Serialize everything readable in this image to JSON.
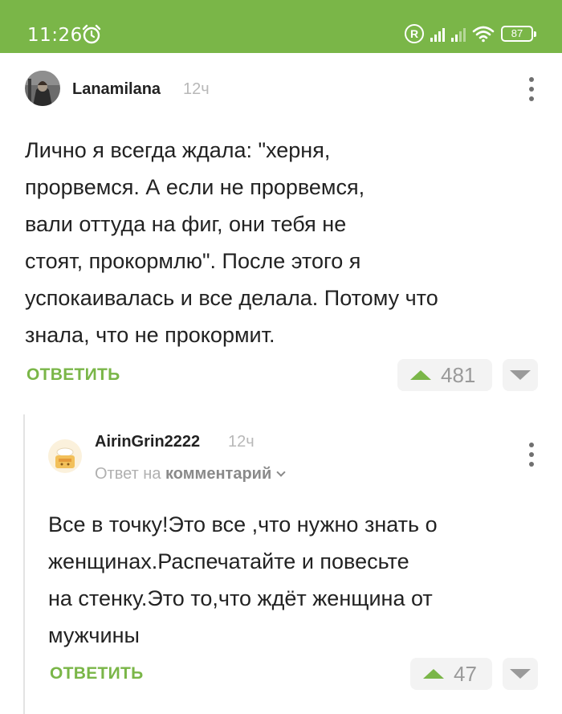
{
  "status_bar": {
    "time": "11:26",
    "battery": "87",
    "accent": "#7ab648",
    "icons": [
      "alarm-icon",
      "registered-icon",
      "signal-icon",
      "signal-icon",
      "wifi-icon",
      "battery-icon"
    ]
  },
  "comments": [
    {
      "author": "Lanamilana",
      "ago": "12ч",
      "text_lines": [
        "Лично я всегда ждала: \"херня,",
        "прорвемся. А если не прорвемся,",
        "вали оттуда на фиг, они тебя не",
        "стоят, прокормлю\". После этого я",
        "успокаивалась и все делала. Потому что",
        "знала, что не прокормит."
      ],
      "reply_label": "ОТВЕТИТЬ",
      "votes": "481"
    },
    {
      "author": "AirinGrin2222",
      "ago": "12ч",
      "answer_prefix": "Ответ на",
      "answer_target": "комментарий",
      "text_lines": [
        "Все в точку!Это все ,что нужно знать о",
        "женщинах.Распечатайте и повесьте",
        "на стенку.Это то,что ждёт женщина от",
        "мужчины"
      ],
      "reply_label": "ОТВЕТИТЬ",
      "votes": "47"
    }
  ]
}
